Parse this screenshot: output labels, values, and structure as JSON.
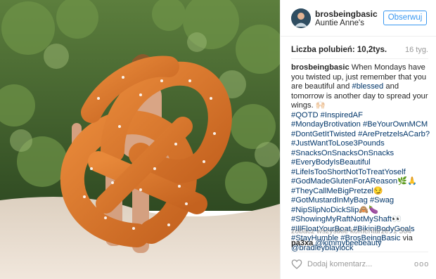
{
  "post": {
    "username": "brosbeingbasic",
    "location": "Auntie Anne's",
    "follow_label": "Obserwuj",
    "likes": "Liczba polubień: 10,2tys.",
    "age": "16 tyg."
  },
  "caption": {
    "username": "brosbeingbasic",
    "text_1": " When Mondays have you twisted up, just remember that you are beautiful and ",
    "tag_blessed": "#blessed",
    "text_2": " and tomorrow is another day to spread your wings. 🙌🏻",
    "hashtags": [
      "#QOTD",
      "#InspiredAF",
      "#MondayBrotivation",
      "#BeYourOwnMCM",
      "#DontGetItTwisted",
      "#ArePretzelsACarb?",
      "#JustWantToLose3Pounds",
      "#SnacksOnSnacksOnSnacks",
      "#EveryBodyIsBeautiful",
      "#LifeIsTooShortNotToTreatYoself",
      "#GodMadeGlutenForAReason🌿🙏",
      "#TheyCallMeBigPretzel😏",
      "#GotMustardInMyBag",
      "#Swag",
      "#NipSlipNoDickSlip🙈🍆",
      "#ShowingMyRaftNotMyShaft👀",
      "#IllFloatYourBoat",
      "#BikiniBodyGoals",
      "#StayHumble",
      "#BrosBeingBasic"
    ],
    "via": " via ",
    "mention": "@bradleyblaylock"
  },
  "comments": {
    "view_all": "zobacz wszystkie komentarze: 1 504",
    "first_user": "pa3xa",
    "first_text": "@kimmybeebeauty"
  },
  "actions": {
    "like_icon": "heart-icon",
    "add_comment_placeholder": "Dodaj komentarz...",
    "more_label": "ooo"
  },
  "colors": {
    "link": "#003569",
    "follow_blue": "#3897f0",
    "muted": "#999999",
    "pretzel": "#d9782e",
    "sand": "#e9ddd0",
    "foliage": "#3d5e2a"
  }
}
